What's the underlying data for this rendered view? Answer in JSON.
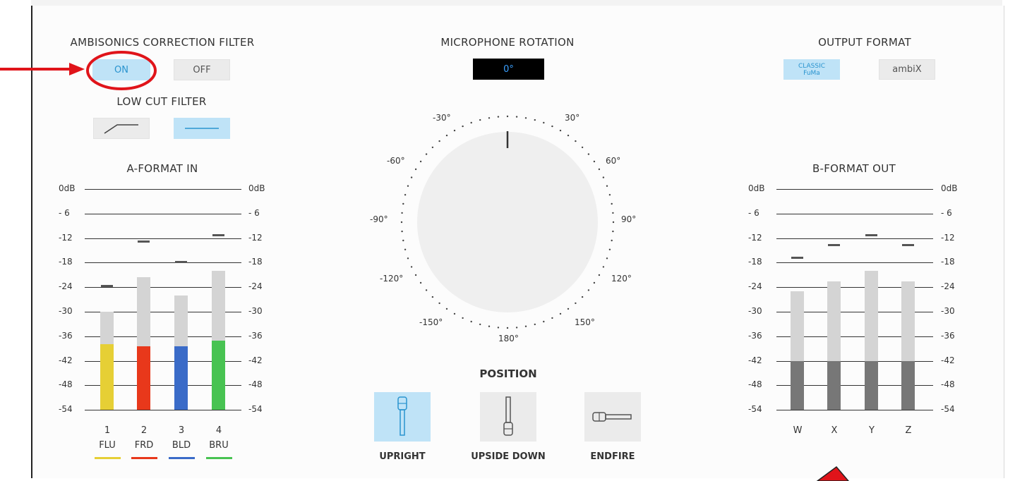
{
  "correction": {
    "title": "AMBISONICS CORRECTION FILTER",
    "on_label": "ON",
    "off_label": "OFF",
    "selected": "ON"
  },
  "lowcut": {
    "title": "LOW CUT FILTER",
    "selected": "flat",
    "options": [
      "high-pass-curve-icon",
      "flat-line-icon"
    ]
  },
  "rotation": {
    "title": "MICROPHONE ROTATION",
    "value": "0°",
    "angle_labels": [
      "-30°",
      "30°",
      "-60°",
      "60°",
      "-90°",
      "90°",
      "-120°",
      "120°",
      "-150°",
      "150°",
      "180°"
    ]
  },
  "output": {
    "title": "OUTPUT FORMAT",
    "classic_line1": "CLASSIC",
    "classic_line2": "FuMa",
    "ambix_label": "ambiX",
    "selected": "CLASSIC FuMa"
  },
  "scale_labels": [
    "0dB",
    "- 6",
    "-12",
    "-18",
    "-24",
    "-30",
    "-36",
    "-42",
    "-48",
    "-54"
  ],
  "a_format": {
    "title": "A-FORMAT IN",
    "channels": [
      {
        "num": "1",
        "name": "FLU",
        "color": "#e6cf35",
        "peak_db": -23.5,
        "level_db": -30,
        "fill_db": -38
      },
      {
        "num": "2",
        "name": "FRD",
        "color": "#e8381b",
        "peak_db": -12.5,
        "level_db": -21.5,
        "fill_db": -38.5
      },
      {
        "num": "3",
        "name": "BLD",
        "color": "#3a6bc8",
        "peak_db": -17.5,
        "level_db": -26,
        "fill_db": -38.5
      },
      {
        "num": "4",
        "name": "BRU",
        "color": "#48c352",
        "peak_db": -11,
        "level_db": -20,
        "fill_db": -37
      }
    ]
  },
  "b_format": {
    "title": "B-FORMAT OUT",
    "channels": [
      {
        "name": "W",
        "peak_db": -16.5,
        "level_db": -25,
        "fill_db": -42
      },
      {
        "name": "X",
        "peak_db": -13.5,
        "level_db": -22.5,
        "fill_db": -42
      },
      {
        "name": "Y",
        "peak_db": -11,
        "level_db": -20,
        "fill_db": -42
      },
      {
        "name": "Z",
        "peak_db": -13.5,
        "level_db": -22.5,
        "fill_db": -42
      }
    ],
    "fill_color": "#777777"
  },
  "position": {
    "title": "POSITION",
    "options": [
      "UPRIGHT",
      "UPSIDE DOWN",
      "ENDFIRE"
    ],
    "selected": "UPRIGHT"
  },
  "annotation": {
    "arrow_color": "#e0141a"
  }
}
